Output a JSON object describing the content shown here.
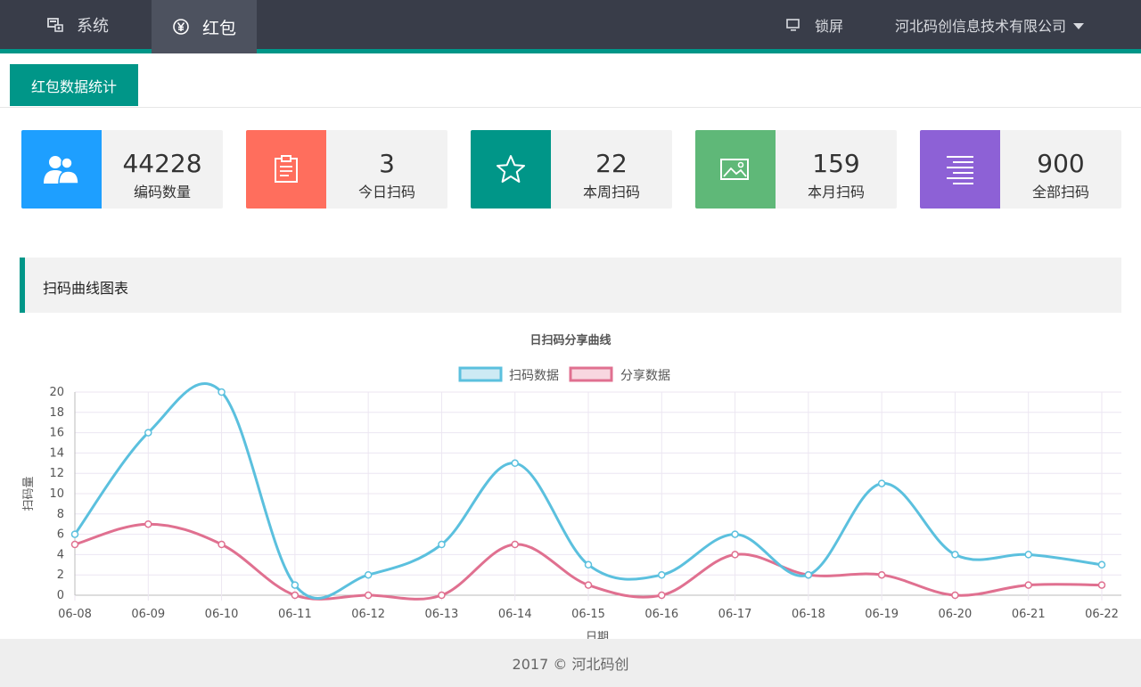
{
  "nav": {
    "system_label": "系统",
    "hongbao_label": "红包",
    "lock_label": "锁屏",
    "company_label": "河北码创信息技术有限公司"
  },
  "tabs": [
    {
      "label": "红包数据统计"
    }
  ],
  "stats": [
    {
      "value": "44228",
      "label": "编码数量",
      "color": "#1e9fff",
      "icon": "users-icon"
    },
    {
      "value": "3",
      "label": "今日扫码",
      "color": "#ff6e5d",
      "icon": "clipboard-icon"
    },
    {
      "value": "22",
      "label": "本周扫码",
      "color": "#009688",
      "icon": "star-icon"
    },
    {
      "value": "159",
      "label": "本月扫码",
      "color": "#5fb878",
      "icon": "image-icon"
    },
    {
      "value": "900",
      "label": "全部扫码",
      "color": "#8d61d6",
      "icon": "align-lines-icon"
    }
  ],
  "section": {
    "title": "扫码曲线图表"
  },
  "chart_data": {
    "type": "line",
    "title": "日扫码分享曲线",
    "xlabel": "日期",
    "ylabel": "扫码量",
    "ylim": [
      0,
      20
    ],
    "yticks": [
      0,
      2,
      4,
      6,
      8,
      10,
      12,
      14,
      16,
      18,
      20
    ],
    "grid": true,
    "legend_position": "top-center",
    "categories": [
      "06-08",
      "06-09",
      "06-10",
      "06-11",
      "06-12",
      "06-13",
      "06-14",
      "06-15",
      "06-16",
      "06-17",
      "06-18",
      "06-19",
      "06-20",
      "06-21",
      "06-22"
    ],
    "series": [
      {
        "name": "扫码数据",
        "color": "#5bc0de",
        "values": [
          6,
          16,
          20,
          1,
          2,
          5,
          13,
          3,
          2,
          6,
          2,
          11,
          4,
          4,
          3
        ]
      },
      {
        "name": "分享数据",
        "color": "#e07090",
        "values": [
          5,
          7,
          5,
          0,
          0,
          0,
          5,
          1,
          0,
          4,
          2,
          2,
          0,
          1,
          1
        ]
      }
    ]
  },
  "footer": {
    "text": "2017 © 河北码创"
  }
}
